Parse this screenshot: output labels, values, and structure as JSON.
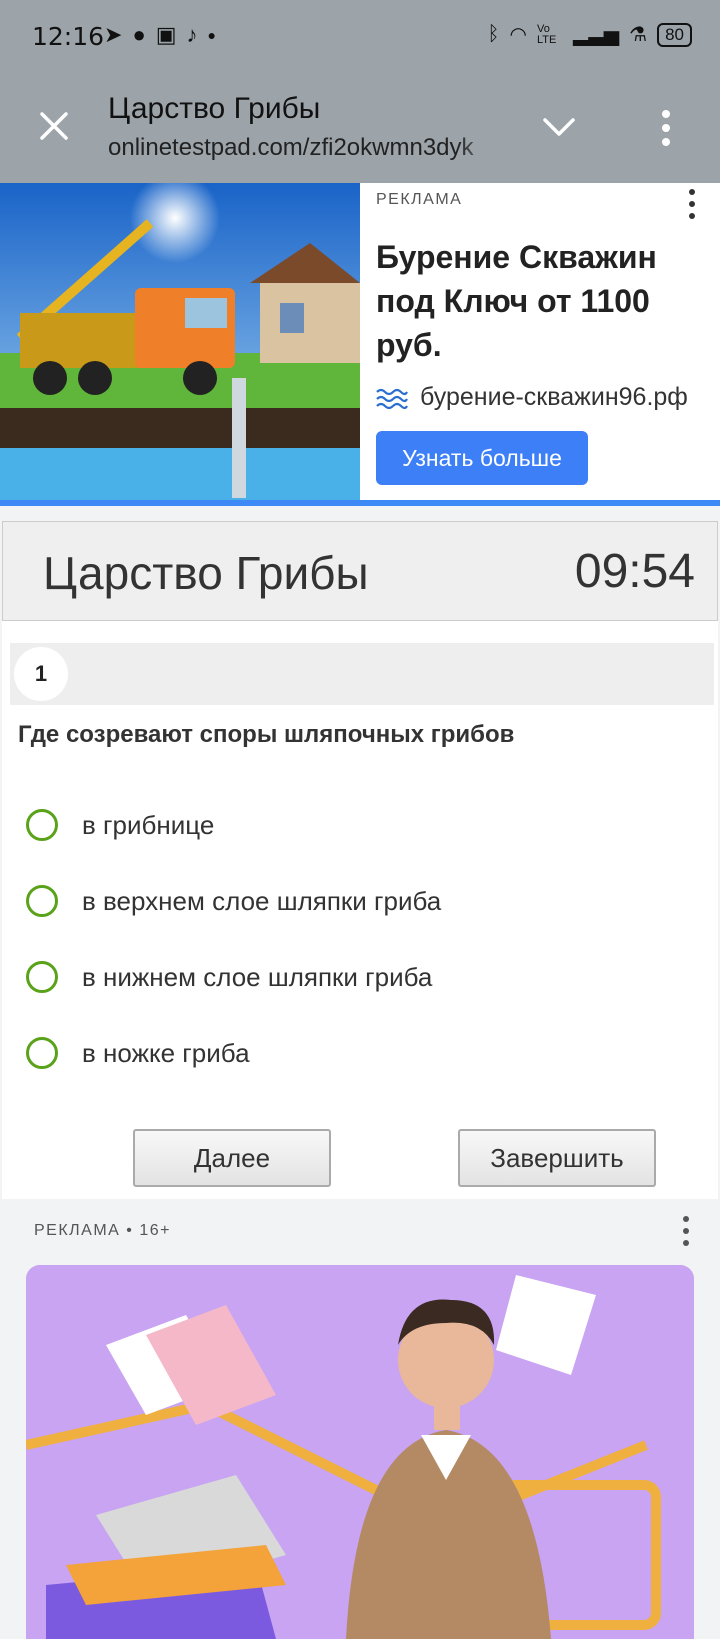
{
  "status": {
    "time": "12:16",
    "icons": [
      "telegram-icon",
      "chat-icon",
      "app-icon",
      "tiktok-icon",
      "dot-icon"
    ],
    "net_label": "Vo LTE",
    "battery": "80"
  },
  "toolbar": {
    "title": "Царство Грибы",
    "url": "onlinetestpad.com/zfi2okwmn3dyk"
  },
  "ad_top": {
    "label": "РЕКЛАМА",
    "headline": "Бурение Скважин под Ключ от 1100 руб.",
    "site": "бурение-скважин96.рф",
    "button": "Узнать больше",
    "accent": "#3d7ff7"
  },
  "test": {
    "title": "Царство Грибы",
    "timer": "09:54",
    "question_number": "1",
    "question": "Где созревают споры шляпочных грибов",
    "options": [
      "в грибнице",
      "в верхнем слое шляпки гриба",
      "в нижнем слое шляпки гриба",
      "в ножке гриба"
    ],
    "radio_color": "#5aa21a",
    "next_button": "Далее",
    "finish_button": "Завершить"
  },
  "ad_bottom": {
    "label": "РЕКЛАМА • 16+",
    "background": "#c8a4f2"
  }
}
